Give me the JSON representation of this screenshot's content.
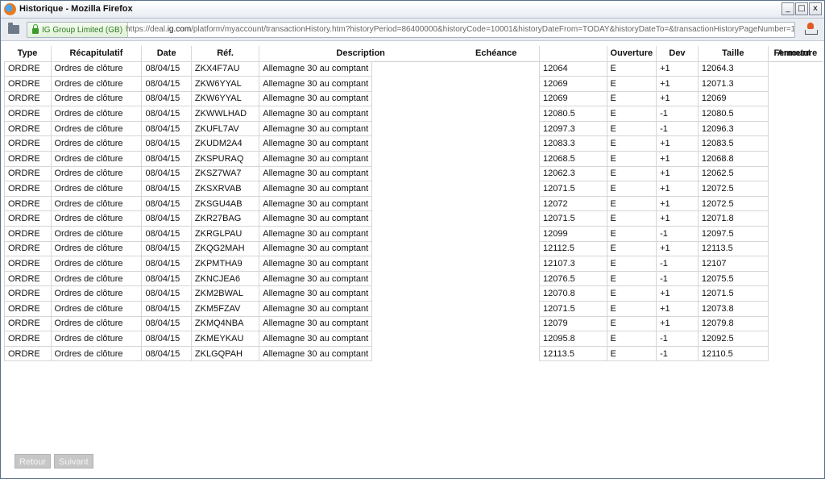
{
  "window": {
    "title": "Historique - Mozilla Firefox",
    "controls": [
      "_",
      "□",
      "x"
    ]
  },
  "addressbar": {
    "identity": "IG Group Limited (GB)",
    "url_prefix": "https://deal.",
    "url_domain": "ig.com",
    "url_rest": "/platform/myaccount/transactionHistory.htm?historyPeriod=86400000&historyCode=10001&historyDateFrom=TODAY&historyDateTo=&transactionHistoryPageNumber=1&tra"
  },
  "table": {
    "columns": [
      "Type",
      "Récapitulatif",
      "Date",
      "Réf.",
      "Description",
      "Echéance",
      "Ouverture",
      "Dev",
      "Taille",
      "Fermeture",
      "Amount"
    ],
    "rows": [
      [
        "ORDRE",
        "Ordres de clôture",
        "08/04/15",
        "ZKX4F7AU",
        "Allemagne 30 au comptant",
        "12064",
        "E",
        "+1",
        "12064.3"
      ],
      [
        "ORDRE",
        "Ordres de clôture",
        "08/04/15",
        "ZKW6YYAL",
        "Allemagne 30 au comptant",
        "12069",
        "E",
        "+1",
        "12071.3"
      ],
      [
        "ORDRE",
        "Ordres de clôture",
        "08/04/15",
        "ZKW6YYAL",
        "Allemagne 30 au comptant",
        "12069",
        "E",
        "+1",
        "12069"
      ],
      [
        "ORDRE",
        "Ordres de clôture",
        "08/04/15",
        "ZKWWLHAD",
        "Allemagne 30 au comptant",
        "12080.5",
        "E",
        "-1",
        "12080.5"
      ],
      [
        "ORDRE",
        "Ordres de clôture",
        "08/04/15",
        "ZKUFL7AV",
        "Allemagne 30 au comptant",
        "12097.3",
        "E",
        "-1",
        "12096.3"
      ],
      [
        "ORDRE",
        "Ordres de clôture",
        "08/04/15",
        "ZKUDM2A4",
        "Allemagne 30 au comptant",
        "12083.3",
        "E",
        "+1",
        "12083.5"
      ],
      [
        "ORDRE",
        "Ordres de clôture",
        "08/04/15",
        "ZKSPURAQ",
        "Allemagne 30 au comptant",
        "12068.5",
        "E",
        "+1",
        "12068.8"
      ],
      [
        "ORDRE",
        "Ordres de clôture",
        "08/04/15",
        "ZKSZ7WA7",
        "Allemagne 30 au comptant",
        "12062.3",
        "E",
        "+1",
        "12062.5"
      ],
      [
        "ORDRE",
        "Ordres de clôture",
        "08/04/15",
        "ZKSXRVAB",
        "Allemagne 30 au comptant",
        "12071.5",
        "E",
        "+1",
        "12072.5"
      ],
      [
        "ORDRE",
        "Ordres de clôture",
        "08/04/15",
        "ZKSGU4AB",
        "Allemagne 30 au comptant",
        "12072",
        "E",
        "+1",
        "12072.5"
      ],
      [
        "ORDRE",
        "Ordres de clôture",
        "08/04/15",
        "ZKR27BAG",
        "Allemagne 30 au comptant",
        "12071.5",
        "E",
        "+1",
        "12071.8"
      ],
      [
        "ORDRE",
        "Ordres de clôture",
        "08/04/15",
        "ZKRGLPAU",
        "Allemagne 30 au comptant",
        "12099",
        "E",
        "-1",
        "12097.5"
      ],
      [
        "ORDRE",
        "Ordres de clôture",
        "08/04/15",
        "ZKQG2MAH",
        "Allemagne 30 au comptant",
        "12112.5",
        "E",
        "+1",
        "12113.5"
      ],
      [
        "ORDRE",
        "Ordres de clôture",
        "08/04/15",
        "ZKPMTHA9",
        "Allemagne 30 au comptant",
        "12107.3",
        "E",
        "-1",
        "12107"
      ],
      [
        "ORDRE",
        "Ordres de clôture",
        "08/04/15",
        "ZKNCJEA6",
        "Allemagne 30 au comptant",
        "12076.5",
        "E",
        "-1",
        "12075.5"
      ],
      [
        "ORDRE",
        "Ordres de clôture",
        "08/04/15",
        "ZKM2BWAL",
        "Allemagne 30 au comptant",
        "12070.8",
        "E",
        "+1",
        "12071.5"
      ],
      [
        "ORDRE",
        "Ordres de clôture",
        "08/04/15",
        "ZKM5FZAV",
        "Allemagne 30 au comptant",
        "12071.5",
        "E",
        "+1",
        "12073.8"
      ],
      [
        "ORDRE",
        "Ordres de clôture",
        "08/04/15",
        "ZKMQ4NBA",
        "Allemagne 30 au comptant",
        "12079",
        "E",
        "+1",
        "12079.8"
      ],
      [
        "ORDRE",
        "Ordres de clôture",
        "08/04/15",
        "ZKMEYKAU",
        "Allemagne 30 au comptant",
        "12095.8",
        "E",
        "-1",
        "12092.5"
      ],
      [
        "ORDRE",
        "Ordres de clôture",
        "08/04/15",
        "ZKLGQPAH",
        "Allemagne 30 au comptant",
        "12113.5",
        "E",
        "-1",
        "12110.5"
      ]
    ]
  },
  "pager": {
    "back": "Retour",
    "next": "Suivant"
  }
}
